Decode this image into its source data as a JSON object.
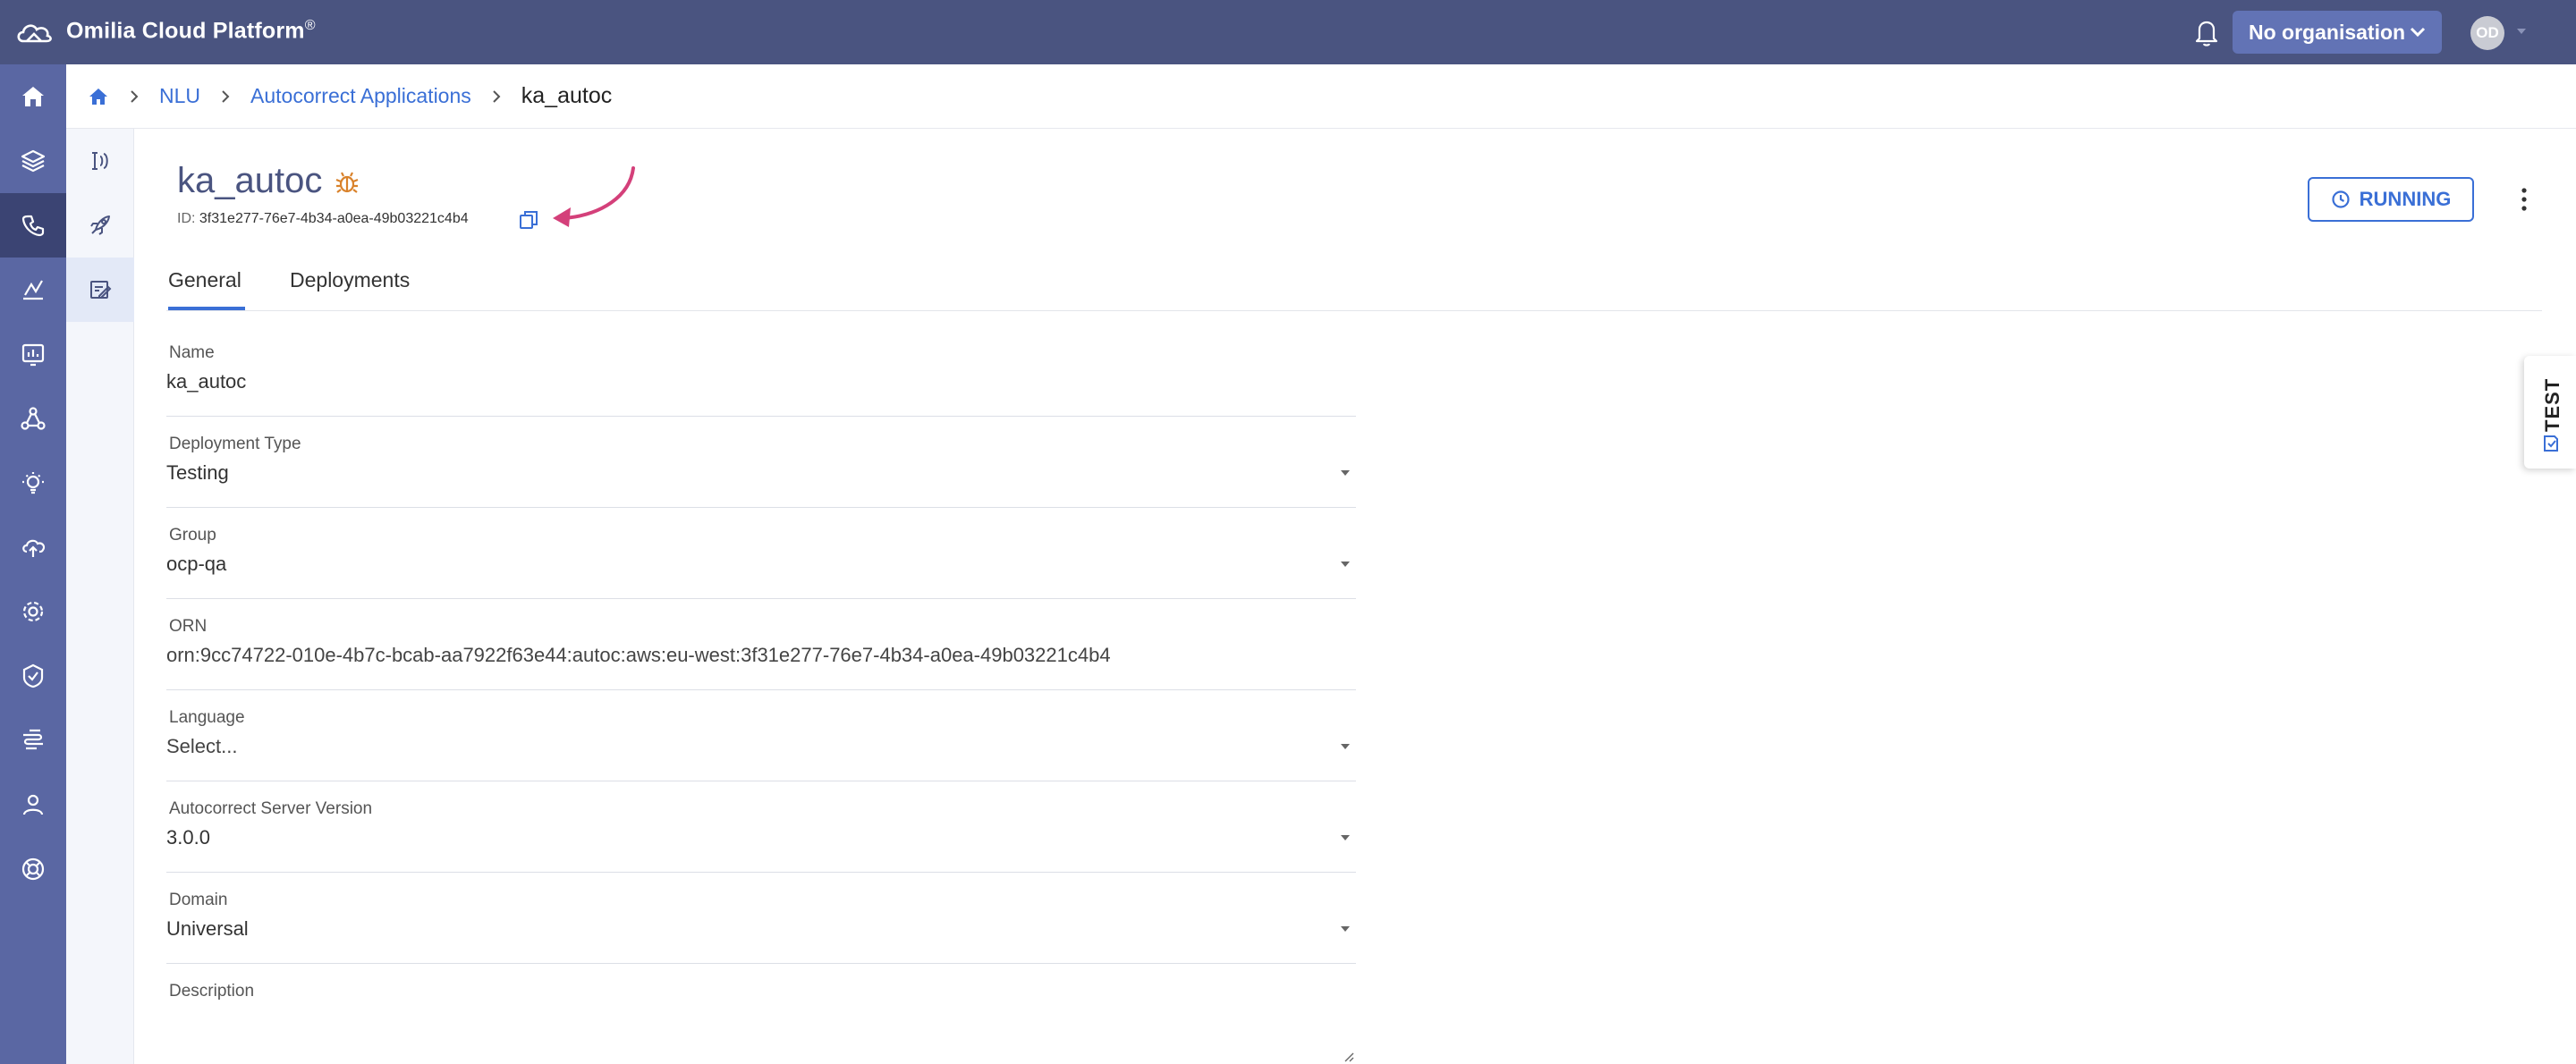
{
  "topbar": {
    "app_name": "Omilia Cloud Platform",
    "registered": "®",
    "org_button": "No organisation",
    "avatar_initials": "OD"
  },
  "rail": {
    "items": [
      "home",
      "layers",
      "nlu",
      "analytics",
      "dashboard",
      "graph",
      "insights",
      "cloud-upload",
      "settings-gear",
      "shield-check",
      "speech",
      "user",
      "support"
    ],
    "active_index": 2
  },
  "subrail": {
    "items": [
      "autocorrect",
      "rocket",
      "edit-doc"
    ],
    "active_index": 2
  },
  "breadcrumb": {
    "items": [
      "NLU",
      "Autocorrect Applications"
    ],
    "current": "ka_autoc"
  },
  "header": {
    "title": "ka_autoc",
    "id_label": "ID:",
    "id_value": "3f31e277-76e7-4b34-a0ea-49b03221c4b4",
    "status": "RUNNING"
  },
  "tabs": [
    "General",
    "Deployments"
  ],
  "form": {
    "name": {
      "label": "Name",
      "value": "ka_autoc"
    },
    "deployment_type": {
      "label": "Deployment Type",
      "value": "Testing"
    },
    "group": {
      "label": "Group",
      "value": "ocp-qa"
    },
    "orn": {
      "label": "ORN",
      "value": "orn:9cc74722-010e-4b7c-bcab-aa7922f63e44:autoc:aws:eu-west:3f31e277-76e7-4b34-a0ea-49b03221c4b4"
    },
    "language": {
      "label": "Language",
      "placeholder": "Select..."
    },
    "server_version": {
      "label": "Autocorrect Server Version",
      "value": "3.0.0"
    },
    "domain": {
      "label": "Domain",
      "value": "Universal"
    },
    "description": {
      "label": "Description",
      "value": ""
    }
  },
  "test_tab": {
    "label": "TEST"
  },
  "colors": {
    "topbar": "#4a5480",
    "rail": "#5a67a3",
    "rail_active": "#3b4473",
    "accent": "#3a6fd6",
    "annotation_arrow": "#d4407a"
  }
}
